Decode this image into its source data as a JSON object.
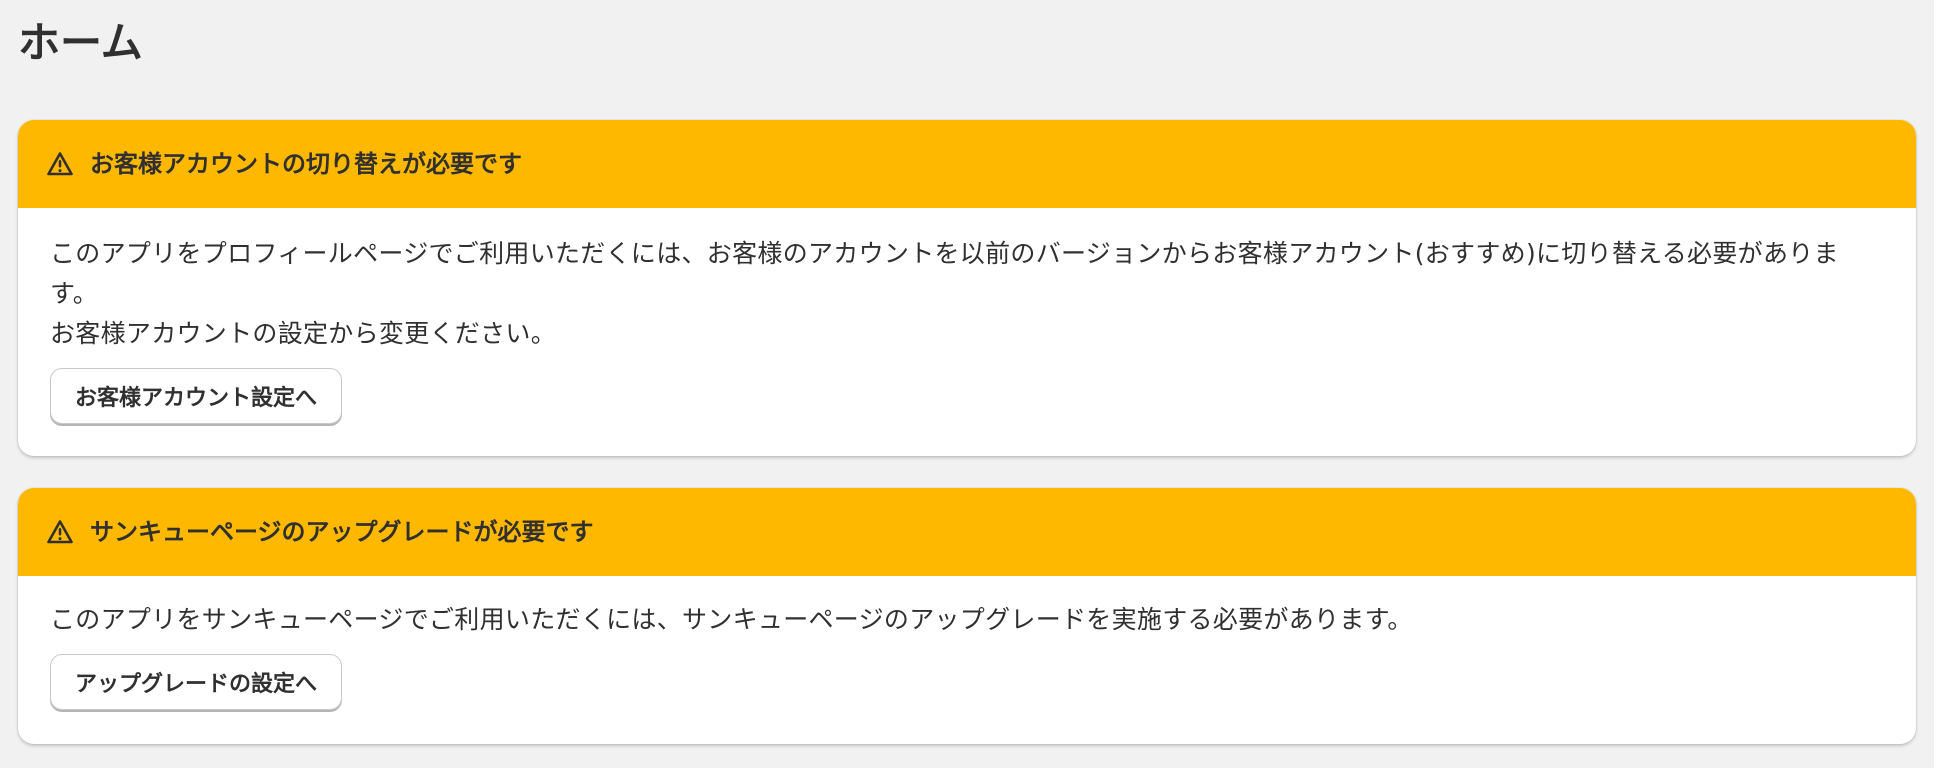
{
  "page": {
    "title": "ホーム"
  },
  "notices": [
    {
      "title": "お客様アカウントの切り替えが必要です",
      "icon": "warning-icon",
      "body_line1": "このアプリをプロフィールページでご利用いただくには、お客様のアカウントを以前のバージョンからお客様アカウント(おすすめ)に切り替える必要があります。",
      "body_line2": "お客様アカウントの設定から変更ください。",
      "button_label": "お客様アカウント設定へ"
    },
    {
      "title": "サンキューページのアップグレードが必要です",
      "icon": "warning-icon",
      "body_line1": "このアプリをサンキューページでご利用いただくには、サンキューページのアップグレードを実施する必要があります。",
      "button_label": "アップグレードの設定へ"
    }
  ],
  "colors": {
    "background": "#f1f1f1",
    "warning_header": "#ffb800",
    "card": "#ffffff",
    "text": "#303030"
  }
}
